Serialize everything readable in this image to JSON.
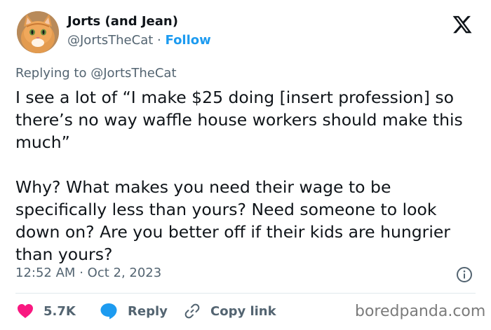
{
  "author": {
    "name": "Jorts (and Jean)",
    "handle": "@JortsTheCat",
    "separator": "·",
    "follow_label": "Follow",
    "avatar_icon": "orange-cat-avatar"
  },
  "header": {
    "logo_icon": "x-logo-icon"
  },
  "reply_context": {
    "prefix": "Replying to",
    "handle": "@JortsTheCat"
  },
  "tweet": {
    "text": "I see a lot of “I make $25 doing [insert profession] so there’s no way waffle house workers should make this much”\n\nWhy? What makes you need their wage to be specifically less than yours? Need someone to look down on? Are you better off if their kids are hungrier than yours?",
    "time": "12:52 AM",
    "date_separator": "·",
    "date": "Oct 2, 2023"
  },
  "actions": {
    "like_count": "5.7K",
    "reply_label": "Reply",
    "copy_link_label": "Copy link"
  },
  "watermark": "boredpanda.com",
  "colors": {
    "like": "#f91880",
    "reply": "#1d9bf0",
    "follow": "#1d9bf0",
    "secondary_text": "#536471"
  }
}
